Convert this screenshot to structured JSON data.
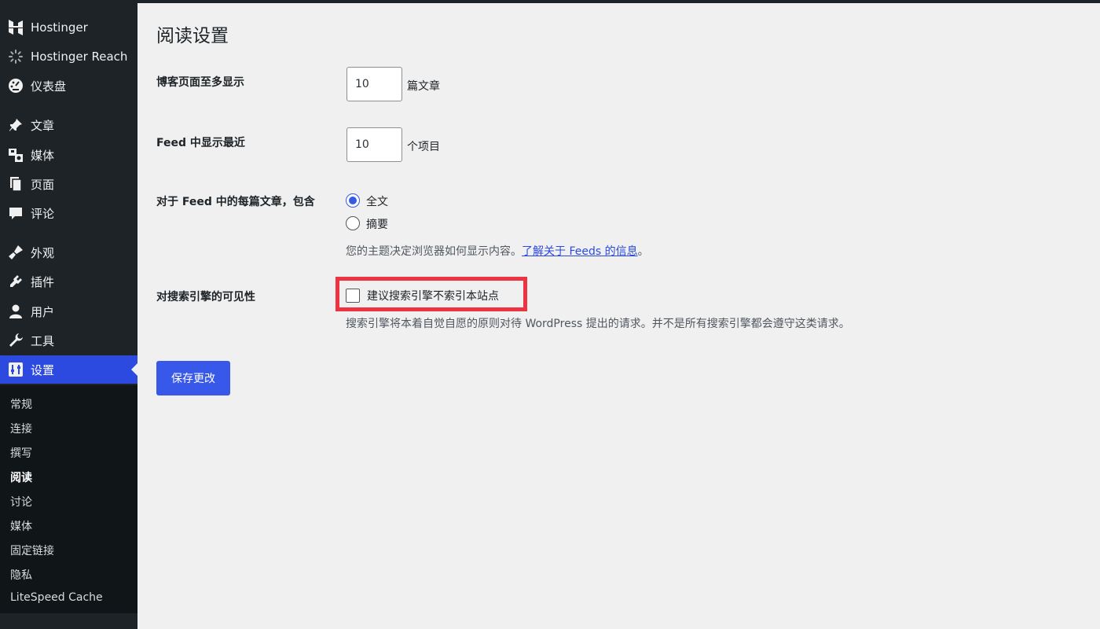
{
  "sidebar": {
    "items": [
      {
        "label": "Hostinger",
        "icon": "hostinger-logo-icon"
      },
      {
        "label": "Hostinger Reach",
        "icon": "spinner-icon"
      },
      {
        "label": "仪表盘",
        "icon": "dashboard-icon"
      },
      {
        "label": "文章",
        "icon": "pin-icon"
      },
      {
        "label": "媒体",
        "icon": "media-icon"
      },
      {
        "label": "页面",
        "icon": "pages-icon"
      },
      {
        "label": "评论",
        "icon": "comment-icon"
      },
      {
        "label": "外观",
        "icon": "appearance-icon"
      },
      {
        "label": "插件",
        "icon": "plugin-icon"
      },
      {
        "label": "用户",
        "icon": "user-icon"
      },
      {
        "label": "工具",
        "icon": "wrench-icon"
      },
      {
        "label": "设置",
        "icon": "settings-icon",
        "active": true
      }
    ],
    "submenu": [
      {
        "label": "常规"
      },
      {
        "label": "连接"
      },
      {
        "label": "撰写"
      },
      {
        "label": "阅读",
        "current": true
      },
      {
        "label": "讨论"
      },
      {
        "label": "媒体"
      },
      {
        "label": "固定链接"
      },
      {
        "label": "隐私"
      },
      {
        "label": "LiteSpeed Cache"
      }
    ]
  },
  "main": {
    "title": "阅读设置",
    "posts_per_page": {
      "label": "博客页面至多显示",
      "value": "10",
      "suffix": "篇文章"
    },
    "feed_items": {
      "label": "Feed 中显示最近",
      "value": "10",
      "suffix": "个项目"
    },
    "feed_content": {
      "label": "对于 Feed 中的每篇文章，包含",
      "options": [
        {
          "label": "全文",
          "checked": true
        },
        {
          "label": "摘要",
          "checked": false
        }
      ],
      "description": "您的主题决定浏览器如何显示内容。",
      "link_text": "了解关于 Feeds 的信息",
      "description_end": "。"
    },
    "visibility": {
      "label": "对搜索引擎的可见性",
      "checkbox_label": "建议搜索引擎不索引本站点",
      "checked": false,
      "description": "搜索引擎将本着自觉自愿的原则对待 WordPress 提出的请求。并不是所有搜索引擎都会遵守这类请求。"
    },
    "save_label": "保存更改"
  },
  "colors": {
    "sidebar_bg": "#1d2327",
    "submenu_bg": "#101517",
    "accent": "#3858e9",
    "highlight": "#ee3340",
    "page_bg": "#f0f0f1"
  }
}
